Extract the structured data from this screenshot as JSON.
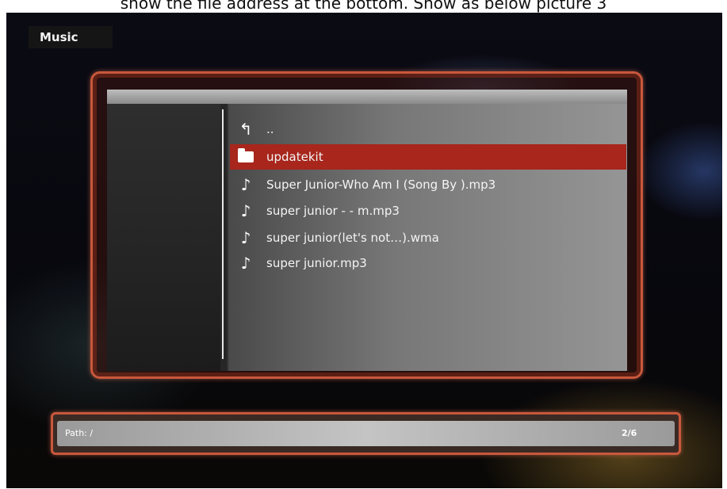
{
  "caption": "show the file address at the bottom. Show as below picture 3",
  "screen": {
    "title": "Music"
  },
  "file_list": {
    "items": [
      {
        "icon": "up-arrow-icon",
        "label": "..",
        "selected": false
      },
      {
        "icon": "folder-icon",
        "label": "updatekit",
        "selected": true
      },
      {
        "icon": "music-note-icon",
        "label": "Super Junior-Who Am I (Song By ).mp3",
        "selected": false
      },
      {
        "icon": "music-note-icon",
        "label": "super junior - - m.mp3",
        "selected": false
      },
      {
        "icon": "music-note-icon",
        "label": "super junior(let's not…).wma",
        "selected": false
      },
      {
        "icon": "music-note-icon",
        "label": "super junior.mp3",
        "selected": false
      }
    ]
  },
  "status": {
    "path": "Path: /",
    "count": "2/6"
  },
  "colors": {
    "selected_row": "#a8261c",
    "frame_border": "#c8583c"
  }
}
